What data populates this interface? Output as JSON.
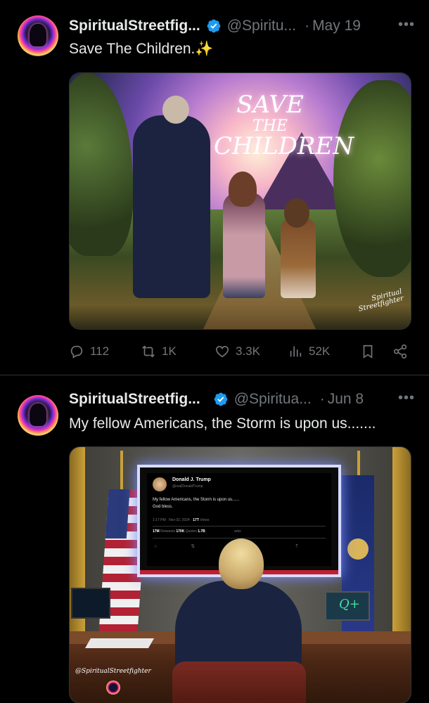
{
  "tweets": [
    {
      "name": "SpiritualStreetfig...",
      "handle": "@Spiritu...",
      "dot": "·",
      "date": "May 19",
      "more": "•••",
      "text": "Save The Children.✨",
      "image": {
        "art_line1": "SAVE",
        "art_line2": "THE",
        "art_line3": "CHILDREN",
        "signature_line1": "Spiritual",
        "signature_line2": "Streetfighter"
      },
      "actions": {
        "replies": "112",
        "retweets": "1K",
        "likes": "3.3K",
        "views": "52K"
      },
      "icons": [
        "reply-icon",
        "retweet-icon",
        "heart-icon",
        "views-icon",
        "bookmark-icon",
        "share-icon"
      ]
    },
    {
      "name": "SpiritualStreetfig...",
      "handle": "@Spiritua...",
      "dot": "·",
      "date": "Jun 8",
      "more": "•••",
      "text": "My fellow Americans, the Storm is upon us.......",
      "image": {
        "screen_name": "Donald J. Trump",
        "screen_handle": "@realDonaldTrump",
        "screen_text_line1": "My fellow Americans, the Storm is upon us......",
        "screen_text_line2": "God bless.",
        "screen_meta_time": "1:17 PM · Nov 02, 2024 ·",
        "screen_meta_views": "17T",
        "screen_meta_views_label": "Views",
        "screen_stats_rt": "17M",
        "screen_stats_rt_label": "Retweets",
        "screen_stats_quotes": "170K",
        "screen_stats_quotes_label": "Quotes",
        "screen_stats_likes": "1.7B",
        "screen_stats_tail": "arks",
        "laptop_logo": "Q+",
        "signature": "@SpiritualStreetfighter"
      }
    }
  ],
  "colors": {
    "background": "#000000",
    "text_primary": "#e7e9ea",
    "text_secondary": "#71767b",
    "verified_blue": "#1d9bf0",
    "divider": "#2f3336"
  }
}
